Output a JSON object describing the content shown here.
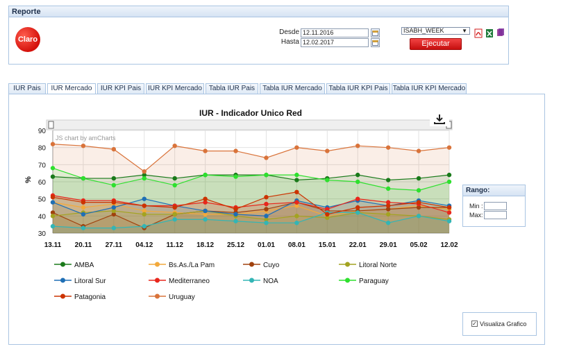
{
  "report": {
    "title": "Reporte",
    "logo_text": "Claro",
    "desde_label": "Desde",
    "desde_value": "12.11.2016",
    "hasta_label": "Hasta",
    "hasta_value": "12.02.2017",
    "select_value": "ISABH_WEEK",
    "run_label": "Ejecutar",
    "export_icons": [
      "pdf-icon",
      "excel-icon",
      "copy-icon"
    ]
  },
  "tabs": [
    {
      "label": "IUR Pais",
      "active": false
    },
    {
      "label": "IUR Mercado",
      "active": true
    },
    {
      "label": "IUR KPI Pais",
      "active": false
    },
    {
      "label": "IUR KPI Mercado",
      "active": false
    },
    {
      "label": "Tabla IUR Pais",
      "active": false
    },
    {
      "label": "Tabla IUR Mercado",
      "active": false
    },
    {
      "label": "Tabla IUR KPI Pais",
      "active": false
    },
    {
      "label": "Tabla IUR KPI Mercado",
      "active": false
    }
  ],
  "rango": {
    "title": "Rango:",
    "min_label": "Min :",
    "max_label": "Max:"
  },
  "visualiza": {
    "label": "Visualiza Grafico",
    "checked": true
  },
  "chart_data": {
    "type": "area",
    "title": "IUR - Indicador Unico Red",
    "watermark": "JS chart by amCharts",
    "ylabel": "%",
    "ylim": [
      30,
      90
    ],
    "yticks": [
      30,
      40,
      50,
      60,
      70,
      80,
      90
    ],
    "categories": [
      "13.11",
      "20.11",
      "27.11",
      "04.12",
      "11.12",
      "18.12",
      "25.12",
      "01.01",
      "08.01",
      "15.01",
      "22.01",
      "29.01",
      "05.02",
      "12.02"
    ],
    "grid": true,
    "legend_position": "bottom",
    "series": [
      {
        "name": "AMBA",
        "color": "#1a7a1a",
        "values": [
          63,
          62,
          62,
          64,
          62,
          64,
          64,
          64,
          61,
          62,
          64,
          61,
          62,
          64
        ]
      },
      {
        "name": "Bs.As./La Pam",
        "color": "#f2a93b",
        "values": [
          48,
          45,
          47,
          43,
          42,
          41,
          41,
          43,
          46,
          40,
          43,
          44,
          46,
          44
        ]
      },
      {
        "name": "Cuyo",
        "color": "#a0410d",
        "values": [
          42,
          34,
          41,
          33,
          41,
          43,
          42,
          44,
          48,
          43,
          43,
          44,
          45,
          45
        ]
      },
      {
        "name": "Litoral Norte",
        "color": "#a3a321",
        "values": [
          40,
          42,
          43,
          41,
          41,
          43,
          40,
          38,
          40,
          39,
          42,
          41,
          40,
          38
        ]
      },
      {
        "name": "Litoral Sur",
        "color": "#1f6fb5",
        "values": [
          48,
          41,
          45,
          50,
          46,
          43,
          41,
          40,
          49,
          45,
          49,
          46,
          49,
          46
        ]
      },
      {
        "name": "Mediterraneo",
        "color": "#e8261c",
        "values": [
          52,
          49,
          49,
          46,
          46,
          48,
          45,
          47,
          48,
          44,
          50,
          48,
          47,
          42
        ]
      },
      {
        "name": "NOA",
        "color": "#33b5b5",
        "values": [
          34,
          33,
          33,
          34,
          38,
          38,
          37,
          36,
          36,
          42,
          42,
          36,
          40,
          37
        ]
      },
      {
        "name": "Paraguay",
        "color": "#2ee02e",
        "values": [
          68,
          62,
          58,
          62,
          58,
          64,
          63,
          64,
          64,
          61,
          60,
          56,
          55,
          60
        ]
      },
      {
        "name": "Patagonia",
        "color": "#cc3300",
        "values": [
          51,
          48,
          48,
          46,
          45,
          50,
          44,
          51,
          54,
          41,
          45,
          46,
          48,
          45
        ]
      },
      {
        "name": "Uruguay",
        "color": "#d9733a",
        "values": [
          82,
          81,
          79,
          66,
          81,
          78,
          78,
          74,
          80,
          78,
          81,
          80,
          78,
          80
        ]
      }
    ]
  }
}
